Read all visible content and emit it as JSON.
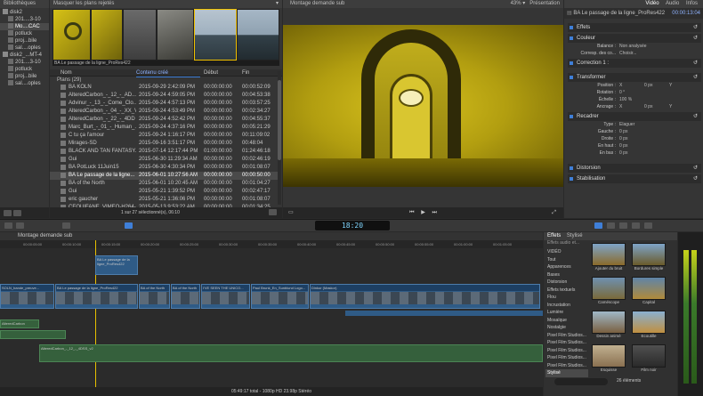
{
  "libraries": {
    "header": "Bibliothèques",
    "items": [
      {
        "label": "disk2",
        "level": 0
      },
      {
        "label": "201....3-10",
        "level": 1
      },
      {
        "label": "Mo....CAC",
        "level": 1,
        "selected": true
      },
      {
        "label": "potluck",
        "level": 1
      },
      {
        "label": "proj...bile",
        "level": 1
      },
      {
        "label": "sal....oples",
        "level": 1
      },
      {
        "label": "disk2_...MT-4",
        "level": 0
      },
      {
        "label": "201....3-10",
        "level": 1
      },
      {
        "label": "potluck",
        "level": 1
      },
      {
        "label": "proj...bile",
        "level": 1
      },
      {
        "label": "sal....oples",
        "level": 1
      }
    ]
  },
  "browser": {
    "filter_label": "Masquer les plans rejetés",
    "filmstrip_caption": "BA Le passage de la ligne_ProRes422",
    "columns": {
      "name": "Nom",
      "content": "Contenu créé",
      "start": "Début",
      "end": "Fin"
    },
    "group_label": "Plans (29)",
    "rows": [
      {
        "name": "BA KOLN",
        "date": "2015-09-29 2:42:09 PM",
        "start": "00:00:00:00",
        "end": "00:00:52:09"
      },
      {
        "name": "AlteredCarbon_-_12_-_AD...",
        "date": "2015-09-24 4:59:05 PM",
        "start": "00:00:00:00",
        "end": "00:04:53:38"
      },
      {
        "name": "Advinur_-_13_-_Come_Clo...",
        "date": "2015-09-24 4:57:13 PM",
        "start": "00:00:00:00",
        "end": "00:03:57:25"
      },
      {
        "name": "AlteredCarbon_-_04_-_XX_VII",
        "date": "2015-09-24 4:53:49 PM",
        "start": "00:00:00:00",
        "end": "00:02:34:27"
      },
      {
        "name": "AlteredCarbon_-_22_-_4DD",
        "date": "2015-09-24 4:52:42 PM",
        "start": "00:00:00:00",
        "end": "00:04:55:37"
      },
      {
        "name": "Marc_Burt_-_01_-_Human_...",
        "date": "2015-09-24 4:37:16 PM",
        "start": "00:00:00:00",
        "end": "00:05:21:29"
      },
      {
        "name": "C tu ça l'amour",
        "date": "2015-09-24 1:16:17 PM",
        "start": "00:00:00:00",
        "end": "00:11:09:02"
      },
      {
        "name": "Mirages-SD",
        "date": "2015-09-16 3:51:17 PM",
        "start": "00:00:00:00",
        "end": "00:48:04"
      },
      {
        "name": "BLACK AND TAN FANTASY...",
        "date": "2015-07-14 12:17:44 PM",
        "start": "01:00:00:00",
        "end": "01:24:46:18"
      },
      {
        "name": "Gui",
        "date": "2015-06-30 11:29:34 AM",
        "start": "00:00:00:00",
        "end": "00:02:46:19"
      },
      {
        "name": "BA PotLuck 11Juin15",
        "date": "2015-06-30 4:30:34 PM",
        "start": "00:00:00:00",
        "end": "00:01:08:07"
      },
      {
        "name": "BA Le passage de la ligne...",
        "date": "2015-06-01 10:27:56 AM",
        "start": "00:00:00:00",
        "end": "00:00:50:00",
        "selected": true
      },
      {
        "name": "BA of the North",
        "date": "2015-06-01 10:20:45 AM",
        "start": "00:00:00:00",
        "end": "00:01:04:27"
      },
      {
        "name": "Gui",
        "date": "2015-05-21 1:39:52 PM",
        "start": "00:00:00:00",
        "end": "00:02:47:17"
      },
      {
        "name": "eric gaucher",
        "date": "2015-05-21 1:36:06 PM",
        "start": "00:00:00:00",
        "end": "00:01:08:07"
      },
      {
        "name": "CEOUIFANE_VIMEO-H264-...",
        "date": "2015-05-13 9:53:22 AM",
        "start": "00:00:00:00",
        "end": "00:01:34:25"
      }
    ],
    "footer": "1 sur 27 sélectionné(s), 06:10"
  },
  "viewer": {
    "title": "Montage demande sub",
    "zoom": "43%",
    "view_label": "Présentation"
  },
  "inspector": {
    "tabs": [
      "Vidéo",
      "Audio",
      "Infos"
    ],
    "clip_name": "BA Le passage de la ligne_ProRes422",
    "timecode": "00:00:13:04",
    "sections": {
      "effects": "Effets",
      "color": "Couleur",
      "balance_label": "Balance :",
      "balance_value": "Non analysée",
      "match_label": "Corresp. des co...",
      "match_button": "Choisir...",
      "correction": "Correction 1 :",
      "transform": "Transformer",
      "position_label": "Position :",
      "rotation_label": "Rotation :",
      "scale_label": "Échelle :",
      "anchor_label": "Ancrage :",
      "crop": "Recadrer",
      "crop_type_label": "Type :",
      "crop_type_value": "Elaguer",
      "left_label": "Gauche :",
      "right_label": "Droite :",
      "top_label": "En haut :",
      "bottom_label": "En bas :",
      "distortion": "Distorsion",
      "stabilization": "Stabilisation",
      "x": "X",
      "y": "Y",
      "zero_px": "0 px",
      "zero_deg": "0 °",
      "hundred_pct": "100 %"
    }
  },
  "timeline": {
    "project_name": "Montage demande sub",
    "timecode_display": "18:20",
    "ruler": [
      "00:00:05:00",
      "00:00:10:00",
      "00:00:15:00",
      "00:00:20:00",
      "00:00:25:00",
      "00:00:30:00",
      "00:00:35:00",
      "00:00:40:00",
      "00:00:45:00",
      "00:00:50:00",
      "00:00:55:00",
      "00:01:00:00",
      "00:01:05:00"
    ],
    "connected_clip": "BA Le passage de la ligne_ProRes422",
    "primary_clips": [
      "SOLN_bande_preuve...",
      "BA Le passage de la ligne_ProRes422",
      "BA of the North",
      "BA of the North",
      "I'VE SEEN THE UNICO...",
      "Paul Brunk_En_Sunblund Logo...",
      "Dinkor (Maskor)"
    ],
    "audio_clips": [
      "AlteredCarbon",
      "AlteredCarbon_-_12_-_4DSS_v2"
    ],
    "status": "05:49:17 total - 1080p HD 23.98p Stéréo"
  },
  "effects_browser": {
    "tabs": [
      "Effets",
      "Stylisé"
    ],
    "subtitle": "Effets audio et...",
    "categories": [
      "VIDÉO",
      "Tout",
      "Apparences",
      "Bases",
      "Distorsion",
      "Effets textuels",
      "Flou",
      "Incrustation",
      "Lumière",
      "Mosaïque",
      "Nostalgie",
      "Pixel Film Studios...",
      "Pixel Film Studios...",
      "Pixel Film Studios...",
      "Pixel Film Studios...",
      "Pixel Film Studios...",
      "Stylisé"
    ],
    "items": [
      {
        "label": "Ajouter du bruit"
      },
      {
        "label": "Bordures simple"
      },
      {
        "label": "Caméscope"
      },
      {
        "label": "Capital"
      },
      {
        "label": "Dessin animé"
      },
      {
        "label": "Ecoutille"
      },
      {
        "label": "Esquisse"
      },
      {
        "label": "Film noir"
      }
    ],
    "count": "26 éléments"
  },
  "colors": {
    "accent": "#3f7fd8",
    "yellow": "#c9b316",
    "clip_blue": "#2f5b86",
    "clip_green": "#35603c"
  }
}
